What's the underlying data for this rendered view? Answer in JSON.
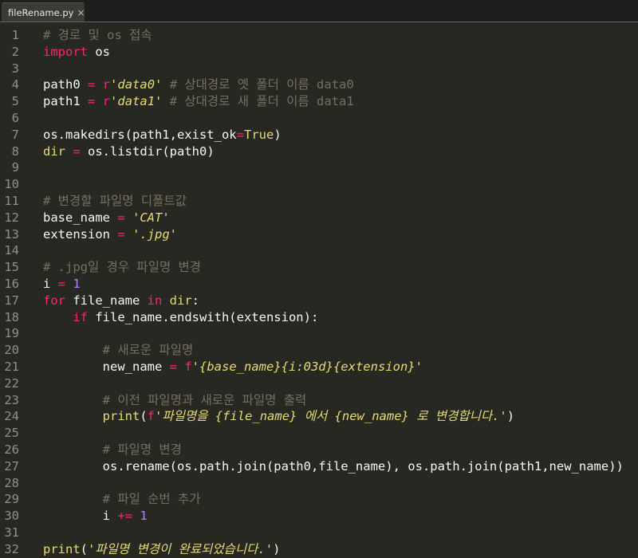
{
  "tab": {
    "filename": "fileRename.py",
    "close_glyph": "×"
  },
  "colors": {
    "background": "#272822",
    "line_number": "#8f908a",
    "keyword": "#f92672",
    "string": "#e6db74",
    "comment": "#75715e",
    "number": "#ae81ff",
    "default": "#f8f8f2"
  },
  "lines": [
    {
      "n": "1",
      "t": [
        [
          "cmt",
          "# 경로 및 os 접속"
        ]
      ]
    },
    {
      "n": "2",
      "t": [
        [
          "kw",
          "import"
        ],
        [
          "",
          " os"
        ]
      ]
    },
    {
      "n": "3",
      "t": []
    },
    {
      "n": "4",
      "t": [
        [
          "",
          "path0 "
        ],
        [
          "kw",
          "="
        ],
        [
          "",
          " "
        ],
        [
          "kw",
          "r"
        ],
        [
          "str ital",
          "'data0'"
        ],
        [
          "",
          ""
        ],
        [
          "cmt",
          " # 상대경로 옛 폴더 이름 data0"
        ]
      ]
    },
    {
      "n": "5",
      "t": [
        [
          "",
          "path1 "
        ],
        [
          "kw",
          "="
        ],
        [
          "",
          " "
        ],
        [
          "kw",
          "r"
        ],
        [
          "str ital",
          "'data1'"
        ],
        [
          "cmt",
          " # 상대경로 새 폴더 이름 data1"
        ]
      ]
    },
    {
      "n": "6",
      "t": []
    },
    {
      "n": "7",
      "t": [
        [
          "",
          "os.makedirs(path1,exist_ok"
        ],
        [
          "kw",
          "="
        ],
        [
          "str",
          "True"
        ],
        [
          "",
          ")"
        ]
      ]
    },
    {
      "n": "8",
      "t": [
        [
          "str",
          "dir"
        ],
        [
          "",
          " "
        ],
        [
          "kw",
          "="
        ],
        [
          "",
          " os.listdir(path0)"
        ]
      ]
    },
    {
      "n": "9",
      "t": []
    },
    {
      "n": "10",
      "t": []
    },
    {
      "n": "11",
      "t": [
        [
          "cmt",
          "# 변경할 파일명 디폴트값"
        ]
      ]
    },
    {
      "n": "12",
      "t": [
        [
          "",
          "base_name "
        ],
        [
          "kw",
          "="
        ],
        [
          "",
          " "
        ],
        [
          "str ital",
          "'CAT'"
        ]
      ]
    },
    {
      "n": "13",
      "t": [
        [
          "",
          "extension "
        ],
        [
          "kw",
          "="
        ],
        [
          "",
          " "
        ],
        [
          "str ital",
          "'.jpg'"
        ]
      ]
    },
    {
      "n": "14",
      "t": []
    },
    {
      "n": "15",
      "t": [
        [
          "cmt",
          "# .jpg일 경우 파일명 변경"
        ]
      ]
    },
    {
      "n": "16",
      "t": [
        [
          "",
          "i "
        ],
        [
          "kw",
          "="
        ],
        [
          "",
          " "
        ],
        [
          "num",
          "1"
        ]
      ]
    },
    {
      "n": "17",
      "t": [
        [
          "kw",
          "for"
        ],
        [
          "",
          " file_name "
        ],
        [
          "kw",
          "in"
        ],
        [
          "",
          " "
        ],
        [
          "str",
          "dir"
        ],
        [
          "",
          ":"
        ]
      ]
    },
    {
      "n": "18",
      "t": [
        [
          "",
          "    "
        ],
        [
          "kw",
          "if"
        ],
        [
          "",
          " file_name.endswith(extension):"
        ]
      ]
    },
    {
      "n": "19",
      "t": []
    },
    {
      "n": "20",
      "t": [
        [
          "",
          "        "
        ],
        [
          "cmt",
          "# 새로운 파일명"
        ]
      ]
    },
    {
      "n": "21",
      "t": [
        [
          "",
          "        new_name "
        ],
        [
          "kw",
          "="
        ],
        [
          "",
          " "
        ],
        [
          "kw",
          "f"
        ],
        [
          "str ital",
          "'{base_name}{i:03d}{extension}'"
        ]
      ]
    },
    {
      "n": "22",
      "t": []
    },
    {
      "n": "23",
      "t": [
        [
          "",
          "        "
        ],
        [
          "cmt",
          "# 이전 파일명과 새로운 파일명 출력"
        ]
      ]
    },
    {
      "n": "24",
      "t": [
        [
          "",
          "        "
        ],
        [
          "str",
          "print"
        ],
        [
          "",
          "("
        ],
        [
          "kw",
          "f"
        ],
        [
          "str ital",
          "'파일명을 {file_name} 에서 {new_name} 로 변경합니다.'"
        ],
        [
          "",
          ")"
        ]
      ]
    },
    {
      "n": "25",
      "t": []
    },
    {
      "n": "26",
      "t": [
        [
          "",
          "        "
        ],
        [
          "cmt",
          "# 파일명 변경"
        ]
      ]
    },
    {
      "n": "27",
      "t": [
        [
          "",
          "        os.rename(os.path.join(path0,file_name), os.path.join(path1,new_name))"
        ]
      ]
    },
    {
      "n": "28",
      "t": []
    },
    {
      "n": "29",
      "t": [
        [
          "",
          "        "
        ],
        [
          "cmt",
          "# 파일 순번 추가"
        ]
      ]
    },
    {
      "n": "30",
      "t": [
        [
          "",
          "        i "
        ],
        [
          "kw",
          "+="
        ],
        [
          "",
          " "
        ],
        [
          "num",
          "1"
        ]
      ]
    },
    {
      "n": "31",
      "t": []
    },
    {
      "n": "32",
      "t": [
        [
          "str",
          "print"
        ],
        [
          "",
          "("
        ],
        [
          "str ital",
          "'파일명 변경이 완료되었습니다.'"
        ],
        [
          "",
          ")"
        ]
      ]
    }
  ]
}
